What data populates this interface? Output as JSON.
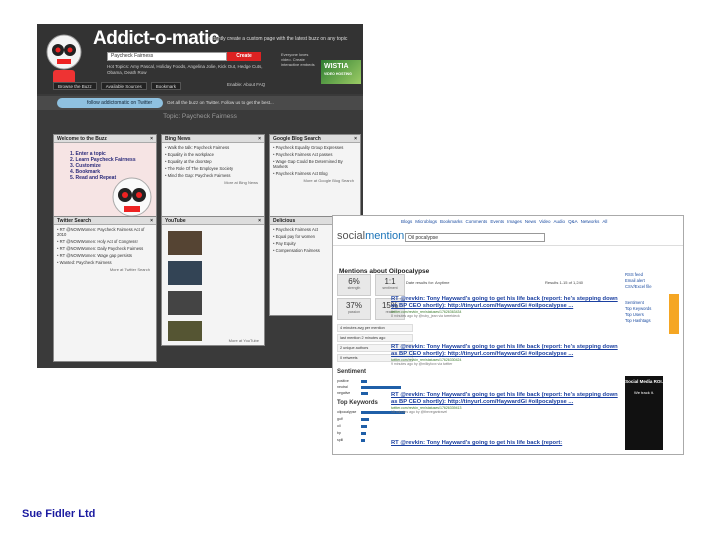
{
  "addictomatic": {
    "logo": "Addict-o-matic",
    "tagline": "Instantly create a custom page with the latest buzz on any topic",
    "search_value": "Paycheck Fairness",
    "create_label": "Create",
    "hot_topics": "Hot Topics: Amy Pascal, Holiday Foods, Angelina Jolie, Kick Out, Hedge Cuts, Obama, Death Row",
    "ad_text": "Everyone loves video. Create interactive embeds",
    "wistia": "WISTIA",
    "wistia_sub": "VIDEO HOSTING",
    "nav": [
      "Browse the Buzz",
      "Available Sources",
      "Bookmark"
    ],
    "enable": "Enable: About  FAQ",
    "twitter_label": "follow addictomatic on Twitter",
    "follow_msg": "Get all the buzz on Twitter. Follow us to get the best...",
    "topic_title": "Topic: Paycheck Fairness",
    "welcome": {
      "title": "Welcome to the Buzz",
      "steps": [
        "1. Enter a topic",
        "2. Learn Paycheck Fairness",
        "3. Customize",
        "4. Bookmark",
        "5. Read and Repeat"
      ]
    },
    "panels": [
      {
        "title": "Bing News",
        "items": [
          "Walk the talk: Paycheck Fairness",
          "Equality in the workplace",
          "Equality at the doorstep",
          "The Role Of The Employee Society",
          "Mind the Gap: Paycheck Fairness"
        ],
        "more": "More at Bing News"
      },
      {
        "title": "Google Blog Search",
        "items": [
          "Paycheck Equality Group Expresses",
          "Paycheck Fairness Act passes",
          "Wage Gap Could Be Determined By Markets",
          "Paycheck Fairness Act Blog"
        ],
        "more": "More at Google Blog Search"
      },
      {
        "title": "Twitter Search",
        "items": [
          "RT @NOWWomen: Paycheck Fairness Act of 2010",
          "RT @NOWWomen: Holy Act of Congress!",
          "RT @NOWWomen: Daily Paycheck Fairness",
          "RT @NOWWomen: Wage gap persists",
          "Wanted: Paycheck Fairness"
        ],
        "more": "More at Twitter Search"
      },
      {
        "title": "YouTube",
        "items": [],
        "more": "More at YouTube"
      },
      {
        "title": "Delicious",
        "items": [
          "Paycheck Fairness Act",
          "Equal pay for women",
          "Pay Equity",
          "Compensation Fairness"
        ],
        "more": ""
      }
    ]
  },
  "socialmention": {
    "logo_a": "social",
    "logo_b": "mention",
    "nav_links": [
      "Blogs",
      "Microblogs",
      "Bookmarks",
      "Comments",
      "Events",
      "Images",
      "News",
      "Video",
      "Audio",
      "Q&A",
      "Networks",
      "All"
    ],
    "search_value": "Oil pocalypse",
    "heading": "Mentions about Oilpocalypse",
    "sort": "Sort by: Date  results for: Anytime",
    "results_info": "Results 1-15 of 1,240",
    "stats": [
      {
        "value": "6%",
        "label": "strength"
      },
      {
        "value": "1:1",
        "label": "sentiment"
      },
      {
        "value": "37%",
        "label": "passion"
      },
      {
        "value": "15%",
        "label": "reach"
      }
    ],
    "side_lines": [
      "4 minutes avg per mention",
      "last mention 2 minutes ago",
      "2 unique authors",
      "0 retweets"
    ],
    "sentiment_title": "Sentiment",
    "sentiment": [
      {
        "label": "positive",
        "value": 8
      },
      {
        "label": "neutral",
        "value": 61
      },
      {
        "label": "negative",
        "value": 9
      }
    ],
    "keywords_title": "Top Keywords",
    "keywords": [
      {
        "label": "oilpocalypse",
        "value": 163
      },
      {
        "label": "gulf",
        "value": 24
      },
      {
        "label": "oil",
        "value": 19
      },
      {
        "label": "bp",
        "value": 14
      },
      {
        "label": "spill",
        "value": 12
      }
    ],
    "results": [
      {
        "title": "RT @revkin: Tony Hayward's going to get his life back (report: he's stepping down as BP CEO shortly): http://tinyurl.com/HaywardGi #oilpocalypse ...",
        "url": "twitter.com/revkin_ren/statuses/17626363434",
        "meta": "8 minutes ago by @ruby_jean via tweetdeck"
      },
      {
        "title": "RT @revkin: Tony Hayward's going to get his life back (report: he's stepping down as BP CEO shortly): http://tinyurl.com/HaywardGi #oilpocalypse ...",
        "url": "twitter.com/revkin_ren/statuses/17626330424",
        "meta": "9 minutes ago by @milkyfoxx via twitter"
      },
      {
        "title": "RT @revkin: Tony Hayward's going to get his life back (report: he's stepping down as BP CEO shortly): http://tinyurl.com/HaywardGi #oilpocalypse ...",
        "url": "twitter.com/revkin_ren/statuses/17626339413",
        "meta": "15 minutes ago by @thevegantravel"
      },
      {
        "title": "RT @revkin: Tony Hayward's going to get his life back (report:",
        "url": "",
        "meta": ""
      }
    ],
    "right_links": [
      "RSS feed",
      "Email alert",
      "CSV/Excel file"
    ],
    "right_links_2": [
      "Sentiment",
      "Top Keywords",
      "Top Users",
      "Top Hashtags"
    ],
    "ad": "Social Media ROI.",
    "ad_sub": "We track it."
  },
  "footer": "Sue Fidler Ltd"
}
